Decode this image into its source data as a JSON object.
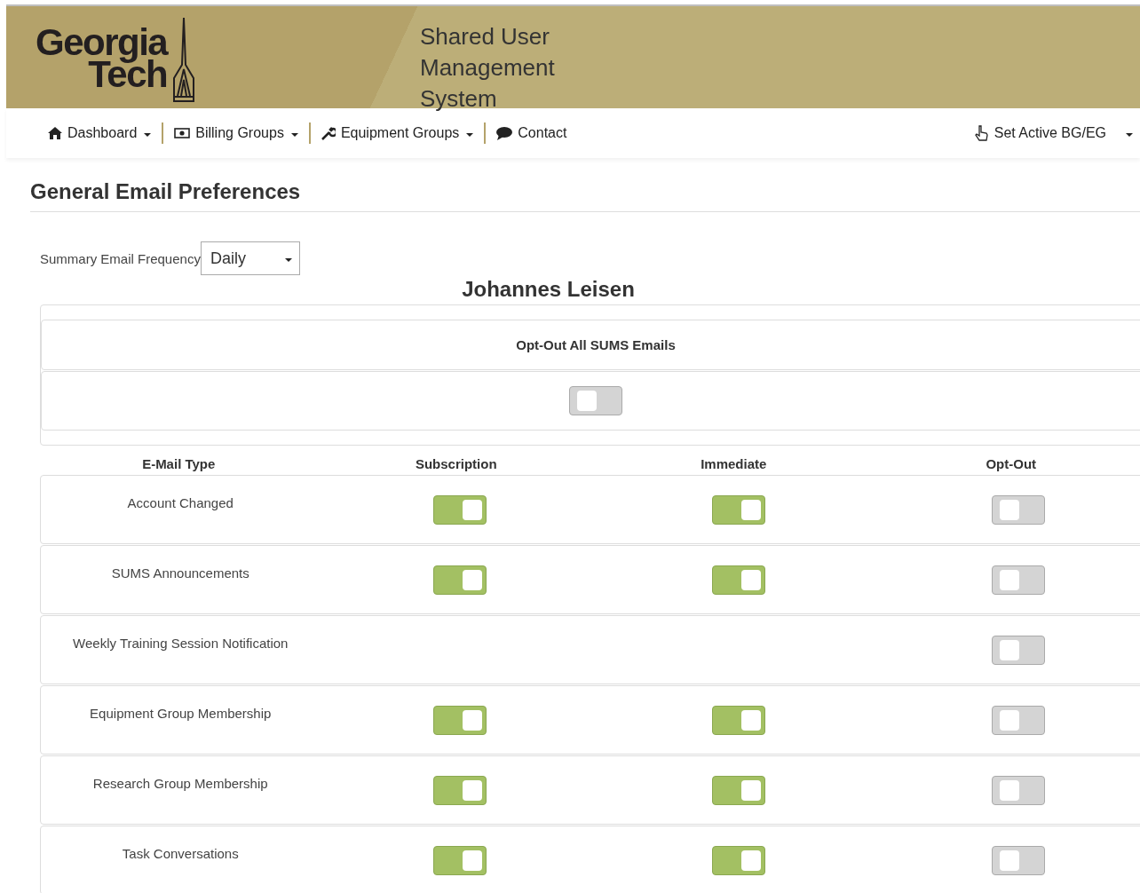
{
  "header": {
    "logo_line1": "Georgia",
    "logo_line2": "Tech",
    "app_title": "Shared User Management System"
  },
  "nav": {
    "items": [
      {
        "label": "Dashboard",
        "kind": "home",
        "dropdown": true
      },
      {
        "label": "Billing Groups",
        "kind": "billing",
        "dropdown": true
      },
      {
        "label": "Equipment Groups",
        "kind": "equipment",
        "dropdown": true
      },
      {
        "label": "Contact",
        "kind": "contact",
        "dropdown": false
      }
    ],
    "right": {
      "label": "Set Active BG/EG",
      "dropdown": true
    }
  },
  "page_title": "General Email Preferences",
  "frequency": {
    "label": "Summary Email Frequency",
    "value": "Daily"
  },
  "user_name": "Johannes Leisen",
  "opt_out_all": {
    "label": "Opt-Out All SUMS Emails",
    "on": false
  },
  "columns": [
    "E-Mail Type",
    "Subscription",
    "Immediate",
    "Opt-Out"
  ],
  "rows": [
    {
      "type": "Account Changed",
      "subscription": true,
      "immediate": true,
      "opt_out": false
    },
    {
      "type": "SUMS Announcements",
      "subscription": true,
      "immediate": true,
      "opt_out": false
    },
    {
      "type": "Weekly Training Session Notification",
      "opt_out": false
    },
    {
      "type": "Equipment Group Membership",
      "subscription": true,
      "immediate": true,
      "opt_out": false
    },
    {
      "type": "Research Group Membership",
      "subscription": true,
      "immediate": true,
      "opt_out": false
    },
    {
      "type": "Task Conversations",
      "subscription": true,
      "immediate": true,
      "opt_out": false
    }
  ]
}
